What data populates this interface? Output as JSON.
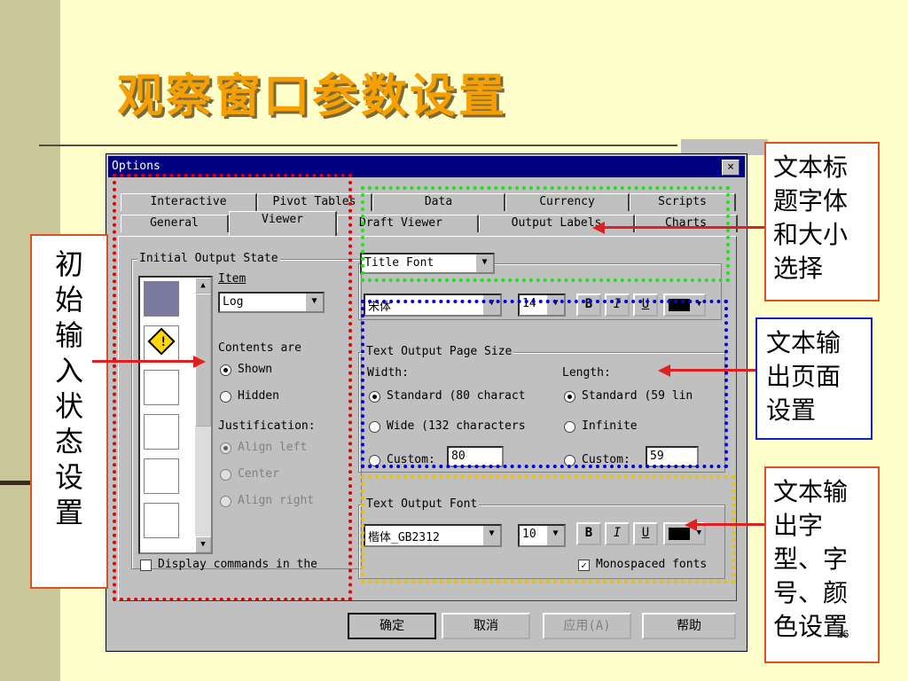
{
  "slide": {
    "title": "观察窗口参数设置",
    "page_number": "26"
  },
  "dialog": {
    "title": "Options",
    "close_label": "×",
    "tabs_row1": [
      "Interactive",
      "Pivot Tables",
      "Data",
      "Currency",
      "Scripts"
    ],
    "tabs_row2": [
      "General",
      "Viewer",
      "Draft Viewer",
      "Output Labels",
      "Charts"
    ],
    "initial_output_state": {
      "group_label": "Initial Output State",
      "item_label": "Item",
      "item_value": "Log",
      "contents_label": "Contents are",
      "shown_label": "Shown",
      "hidden_label": "Hidden",
      "justification_label": "Justification:",
      "align_left": "Align left",
      "center": "Center",
      "align_right": "Align right",
      "display_commands": "Display commands in the"
    },
    "title_font": {
      "select_value": "Title Font",
      "font_value": "宋体",
      "size_value": "14",
      "bold": "B",
      "italic": "I",
      "underline": "U"
    },
    "page_size": {
      "group_label": "Text Output Page Size",
      "width_label": "Width:",
      "length_label": "Length:",
      "width_standard": "Standard (80 charact",
      "width_wide": "Wide (132 characters",
      "width_custom": "Custom:",
      "width_custom_value": "80",
      "length_standard": "Standard (59 lin",
      "length_infinite": "Infinite",
      "length_custom": "Custom:",
      "length_custom_value": "59"
    },
    "text_output_font": {
      "group_label": "Text Output Font",
      "font_value": "楷体_GB2312",
      "size_value": "10",
      "bold": "B",
      "italic": "I",
      "underline": "U",
      "monospaced_label": "Monospaced fonts"
    },
    "buttons": {
      "ok": "确定",
      "cancel": "取消",
      "apply": "应用(A)",
      "help": "帮助"
    }
  },
  "callouts": {
    "left": "初始输入状态设置",
    "title_font": "文本标题字体和大小选择",
    "page_size": "文本输出页面设置",
    "output_font": "文本输出字型、字号、颜色设置"
  },
  "colors": {
    "accent_title": "#f5a000",
    "red_dash": "#e00000",
    "green_dash": "#20e020",
    "blue_dash": "#0000e0",
    "yellow_dash": "#f0c000",
    "arrow": "#e02020"
  }
}
